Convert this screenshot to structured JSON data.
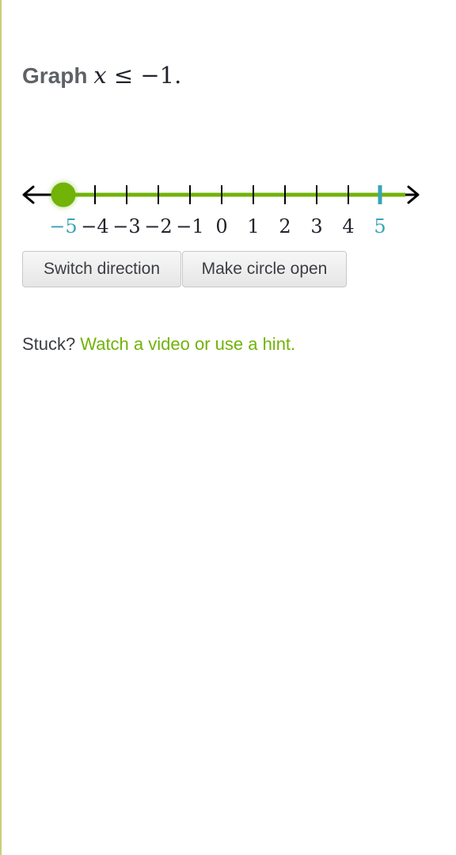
{
  "question": {
    "prefix": "Graph",
    "variable": "x",
    "relation": "≤",
    "value": "−1",
    "suffix": "."
  },
  "number_line": {
    "ticks": [
      -5,
      -4,
      -3,
      -2,
      -1,
      0,
      1,
      2,
      3,
      4,
      5
    ],
    "tick_labels": [
      "−5",
      "−4",
      "−3",
      "−2",
      "−1",
      "0",
      "1",
      "2",
      "3",
      "4",
      "5"
    ],
    "highlighted_ticks": [
      -5,
      5
    ],
    "point_value": -5,
    "point_style": "closed",
    "shaded_direction": "right",
    "colors": {
      "axis": "#000000",
      "shading": "#71b307",
      "point": "#71b307",
      "highlight_tick": "#3aa4b8"
    }
  },
  "buttons": {
    "switch_direction": "Switch direction",
    "make_circle_open": "Make circle open"
  },
  "help": {
    "stuck_label": "Stuck?",
    "hint_link": "Watch a video or use a hint."
  }
}
